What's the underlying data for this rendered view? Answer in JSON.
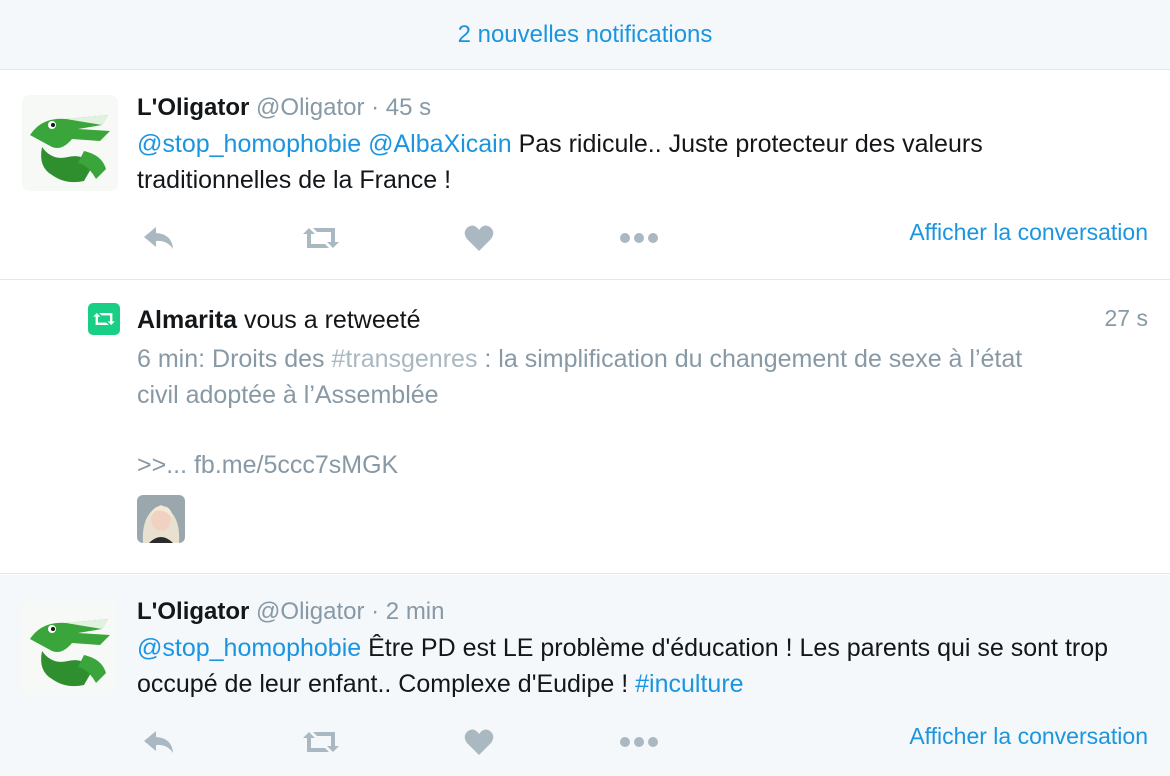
{
  "banner": {
    "label": "2 nouvelles notifications"
  },
  "tweets": [
    {
      "fullname": "L'Oligator",
      "handle": "@Oligator",
      "dot": "·",
      "time": "45 s",
      "mentions": [
        "@stop_homophobie",
        "@AlbaXicain"
      ],
      "text": "Pas ridicule.. Juste protecteur des valeurs traditionnelles de la France !",
      "show_conversation": "Afficher la conversation"
    },
    {
      "fullname": "L'Oligator",
      "handle": "@Oligator",
      "dot": "·",
      "time": "2 min",
      "mention": "@stop_homophobie",
      "text": "Être PD est LE problème d'éducation ! Les parents qui se sont trop occupé de leur enfant.. Complexe d'Eudipe !",
      "hashtag": "#inculture",
      "show_conversation": "Afficher la conversation"
    }
  ],
  "retweet_notification": {
    "user": "Almarita",
    "verb": "vous a retweeté",
    "time": "27 s",
    "text_prefix": "6 min: Droits des ",
    "hashtag": "#transgenres",
    "text_rest": " : la simplification du changement de sexe à l’état civil adoptée à l’Assemblée",
    "link": ">>... fb.me/5ccc7sMGK"
  },
  "icons": {
    "reply": "reply-icon",
    "retweet": "retweet-icon",
    "like": "heart-icon",
    "more": "more-icon"
  },
  "colors": {
    "accent": "#1b95e0",
    "muted": "#8899a6",
    "icon": "#aab8c2",
    "retweet_green": "#19cf86",
    "crocodile": "#3aa53a"
  }
}
